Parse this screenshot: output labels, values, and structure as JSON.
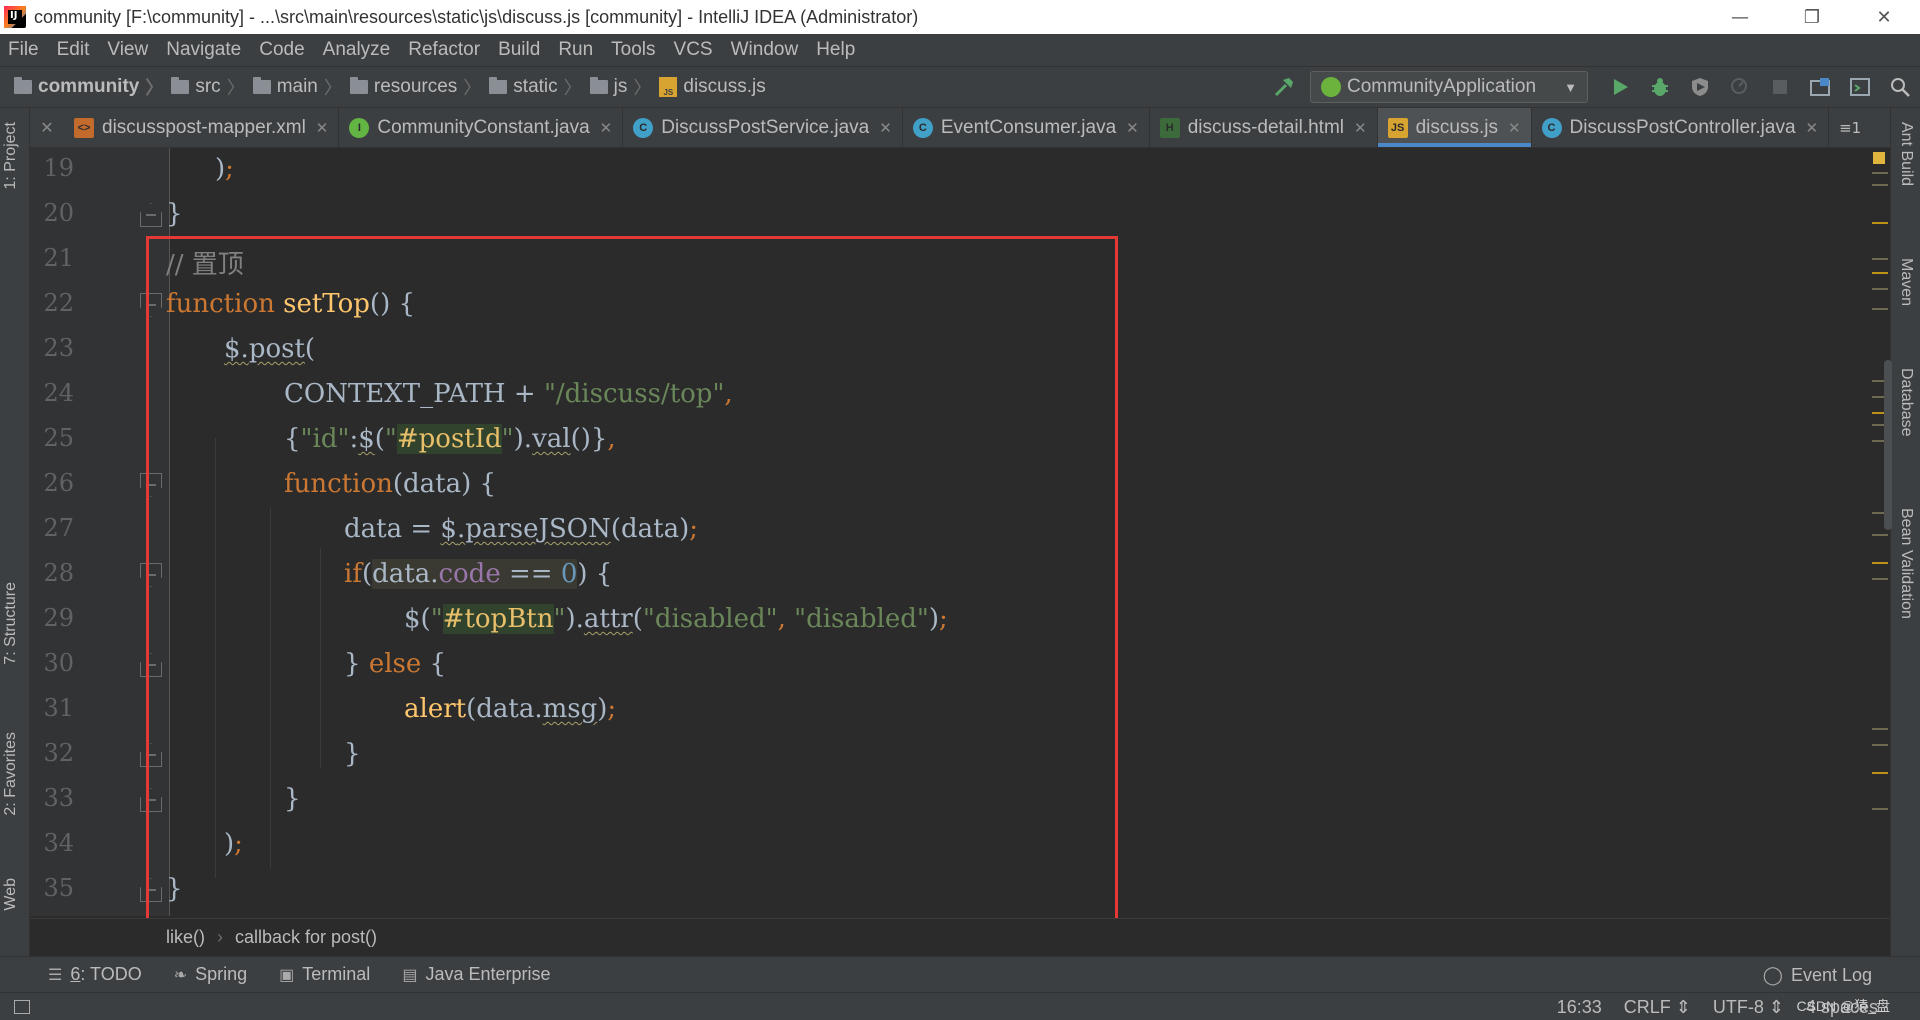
{
  "window": {
    "title": "community [F:\\community] - ...\\src\\main\\resources\\static\\js\\discuss.js [community] - IntelliJ IDEA (Administrator)",
    "minimize": "—",
    "maximize": "❐",
    "close": "✕"
  },
  "menu": [
    "File",
    "Edit",
    "View",
    "Navigate",
    "Code",
    "Analyze",
    "Refactor",
    "Build",
    "Run",
    "Tools",
    "VCS",
    "Window",
    "Help"
  ],
  "breadcrumbs": [
    "community",
    "src",
    "main",
    "resources",
    "static",
    "js",
    "discuss.js"
  ],
  "run_config": {
    "label": "CommunityApplication"
  },
  "tabs": [
    {
      "label": "discusspost-mapper.xml",
      "type": "xml",
      "active": false
    },
    {
      "label": "CommunityConstant.java",
      "type": "iface",
      "active": false
    },
    {
      "label": "DiscussPostService.java",
      "type": "cls",
      "active": false
    },
    {
      "label": "EventConsumer.java",
      "type": "cls",
      "active": false
    },
    {
      "label": "discuss-detail.html",
      "type": "html",
      "active": false
    },
    {
      "label": "discuss.js",
      "type": "js",
      "active": true
    },
    {
      "label": "DiscussPostController.java",
      "type": "cls",
      "active": false
    }
  ],
  "tabs_overflow": "≡1",
  "left_tools": [
    "1: Project",
    "7: Structure",
    "2: Favorites",
    "Web"
  ],
  "right_tools": [
    "Ant Build",
    "Maven",
    "Database",
    "Bean Validation"
  ],
  "code": {
    "line_numbers": [
      "19",
      "20",
      "21",
      "22",
      "23",
      "24",
      "25",
      "26",
      "27",
      "28",
      "29",
      "30",
      "31",
      "32",
      "33",
      "34",
      "35"
    ],
    "l19": {
      "a": ")",
      "b": ";"
    },
    "l20": {
      "a": "}"
    },
    "l21": {
      "a": "// 置顶"
    },
    "l22": {
      "a": "function ",
      "b": "setTop",
      "c": "() {"
    },
    "l23": {
      "a": "$.",
      "b": "post",
      "c": "("
    },
    "l24": {
      "a": "CONTEXT_PATH + ",
      "b": "\"/discuss/top\"",
      "c": ","
    },
    "l25": {
      "a": "{",
      "b": "\"id\"",
      "c": ":",
      "d": "$",
      "e": "(",
      "f": "\"",
      "g": "#postId",
      "h": "\"",
      "i": ").",
      "j": "val",
      "k": "()}",
      "l": ","
    },
    "l26": {
      "a": "function",
      "b": "(data) {"
    },
    "l27": {
      "a": "data = ",
      "b": "$",
      "c": ".",
      "d": "parseJSON",
      "e": "(data)",
      "f": ";"
    },
    "l28": {
      "a": "if",
      "b": "(",
      "c": "data.",
      "d": "code",
      "e": " == ",
      "f": "0",
      "g": ") {"
    },
    "l29": {
      "a": "$",
      "b": "(",
      "c": "\"",
      "d": "#topBtn",
      "e": "\"",
      "f": ").",
      "g": "attr",
      "h": "(",
      "i": "\"disabled\"",
      "j": ", ",
      "k": "\"disabled\"",
      "l": ")",
      "m": ";"
    },
    "l30": {
      "a": "} ",
      "b": "else",
      "c": " {"
    },
    "l31": {
      "a": "alert",
      "b": "(data.",
      "c": "msg",
      "d": ")",
      "e": ";"
    },
    "l32": {
      "a": "}"
    },
    "l33": {
      "a": "}"
    },
    "l34": {
      "a": ")",
      "b": ";"
    },
    "l35": {
      "a": "}"
    }
  },
  "editor_breadcrumbs": [
    "like()",
    "callback for post()"
  ],
  "bottom_tools": [
    {
      "prefix": "6",
      "label": ": TODO"
    },
    {
      "label": "Spring"
    },
    {
      "label": "Terminal"
    },
    {
      "label": "Java Enterprise"
    }
  ],
  "event_log": "Event Log",
  "status": {
    "position": "16:33",
    "line_sep": "CRLF",
    "encoding": "UTF-8",
    "indent": "4 spaces"
  },
  "watermark": "CSDN @猿_盘"
}
